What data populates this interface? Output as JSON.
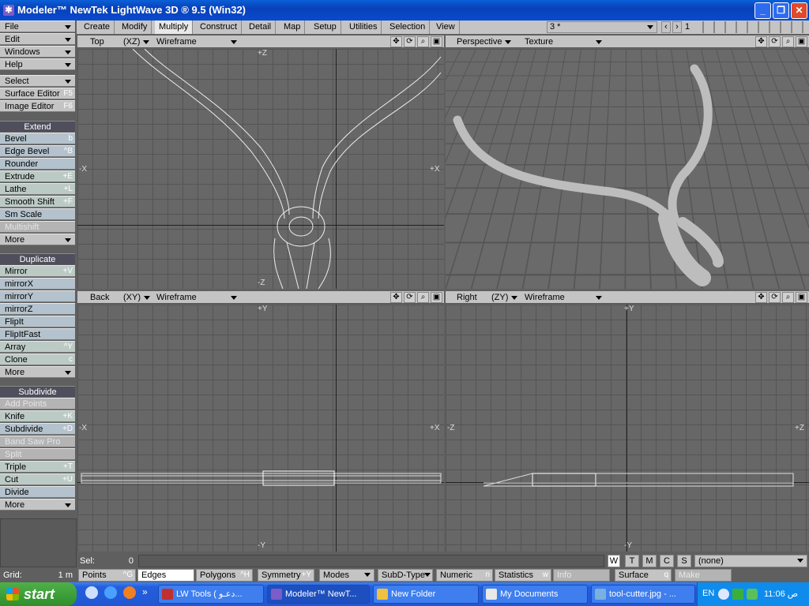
{
  "window": {
    "title": "Modeler™ NewTek LightWave 3D ® 9.5  (Win32)"
  },
  "left_menu": {
    "top": [
      {
        "label": "File"
      },
      {
        "label": "Edit"
      },
      {
        "label": "Windows"
      },
      {
        "label": "Help"
      }
    ],
    "tools": [
      {
        "label": "Select"
      },
      {
        "label": "Surface Editor",
        "shortcut": "F5"
      },
      {
        "label": "Image Editor",
        "shortcut": "F6"
      }
    ],
    "extend_header": "Extend",
    "extend": [
      {
        "label": "Bevel",
        "shortcut": "b"
      },
      {
        "label": "Edge Bevel",
        "shortcut": "^B"
      },
      {
        "label": "Rounder",
        "shortcut": ""
      },
      {
        "label": "Extrude",
        "shortcut": "+E"
      },
      {
        "label": "Lathe",
        "shortcut": "+L"
      },
      {
        "label": "Smooth Shift",
        "shortcut": "+F"
      },
      {
        "label": "Sm Scale",
        "shortcut": ""
      },
      {
        "label": "Multishift",
        "shortcut": ""
      },
      {
        "label": "More",
        "shortcut": ""
      }
    ],
    "duplicate_header": "Duplicate",
    "duplicate": [
      {
        "label": "Mirror",
        "shortcut": "+V"
      },
      {
        "label": "mirrorX",
        "shortcut": ""
      },
      {
        "label": "mirrorY",
        "shortcut": ""
      },
      {
        "label": "mirrorZ",
        "shortcut": ""
      },
      {
        "label": "FlipIt",
        "shortcut": ""
      },
      {
        "label": "FlipItFast",
        "shortcut": ""
      },
      {
        "label": "Array",
        "shortcut": "^Y"
      },
      {
        "label": "Clone",
        "shortcut": "c"
      },
      {
        "label": "More",
        "shortcut": ""
      }
    ],
    "subdivide_header": "Subdivide",
    "subdivide": [
      {
        "label": "Add Points",
        "shortcut": ""
      },
      {
        "label": "Knife",
        "shortcut": "+K"
      },
      {
        "label": "Subdivide",
        "shortcut": "+D"
      },
      {
        "label": "Band Saw Pro",
        "shortcut": ""
      },
      {
        "label": "Split",
        "shortcut": ""
      },
      {
        "label": "Triple",
        "shortcut": "+T"
      },
      {
        "label": "Cut",
        "shortcut": "+U"
      },
      {
        "label": "Divide",
        "shortcut": ""
      },
      {
        "label": "More",
        "shortcut": ""
      }
    ],
    "grid_label": "Grid:",
    "grid_value": "1 m"
  },
  "tabs": [
    "Create",
    "Modify",
    "Multiply",
    "Construct",
    "Detail",
    "Map",
    "Setup",
    "Utilities",
    "Selection",
    "View"
  ],
  "layer_select": "3 *",
  "layer_num": "1",
  "viewports": {
    "top": {
      "view": "Top",
      "axes": "(XZ)",
      "mode": "Wireframe",
      "ax_top": "+Z",
      "ax_bottom": "-Z",
      "ax_left": "-X",
      "ax_right": "+X"
    },
    "persp": {
      "view": "Perspective",
      "mode": "Texture"
    },
    "back": {
      "view": "Back",
      "axes": "(XY)",
      "mode": "Wireframe",
      "ax_top": "+Y",
      "ax_bottom": "-Y",
      "ax_left": "-X",
      "ax_right": "+X"
    },
    "right": {
      "view": "Right",
      "axes": "(ZY)",
      "mode": "Wireframe",
      "ax_top": "+Y",
      "ax_bottom": "-Y",
      "ax_left": "-Z",
      "ax_right": "+Z"
    }
  },
  "status": {
    "sel_label": "Sel:",
    "sel_value": "0",
    "wtmcs": [
      "W",
      "T",
      "M",
      "C",
      "S"
    ],
    "surface_sel": "(none)"
  },
  "bottom_bar": {
    "points": "Points",
    "points_k": "^G",
    "edges": "Edges",
    "polygons": "Polygons",
    "polygons_k": "^H",
    "symmetry": "Symmetry",
    "symmetry_k": "+Y",
    "modes": "Modes",
    "subd": "SubD-Type",
    "numeric": "Numeric",
    "numeric_k": "n",
    "statistics": "Statistics",
    "statistics_k": "w",
    "info": "Info",
    "surface": "Surface",
    "surface_k": "q",
    "make": "Make"
  },
  "taskbar": {
    "start": "start",
    "tasks": [
      "LW Tools ( دعـو...",
      "Modeler™ NewT...",
      "New Folder",
      "My Documents",
      "tool-cutter.jpg - ..."
    ],
    "lang": "EN",
    "clock": "11:06 ص"
  },
  "colors": {
    "titlebar": "#0a4ad0",
    "panel": "#c4c4c4",
    "viewport": "#676767",
    "taskbar": "#245edb"
  }
}
